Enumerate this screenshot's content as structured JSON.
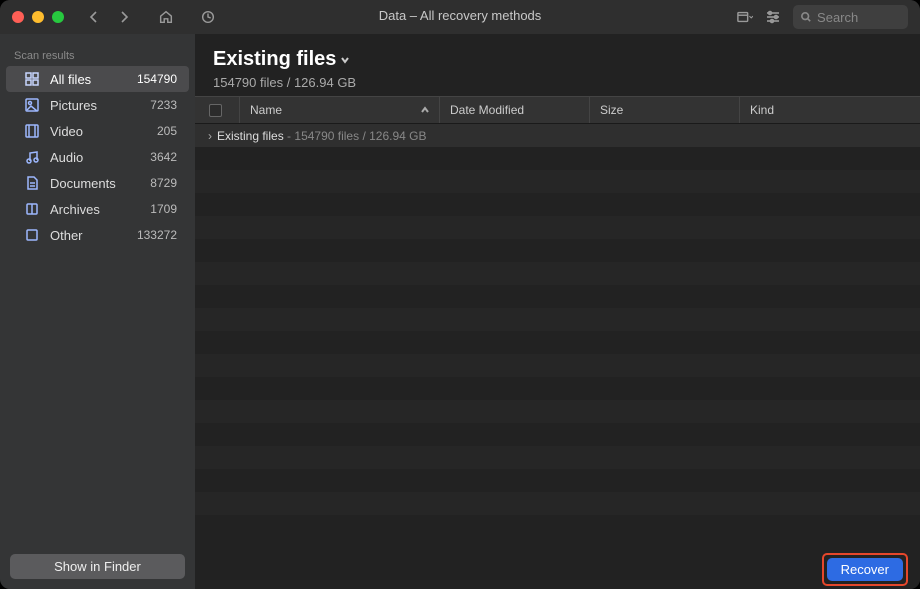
{
  "title": "Data – All recovery methods",
  "search": {
    "placeholder": "Search"
  },
  "sidebar": {
    "heading": "Scan results",
    "items": [
      {
        "label": "All files",
        "count": "154790",
        "icon": "grid"
      },
      {
        "label": "Pictures",
        "count": "7233",
        "icon": "image"
      },
      {
        "label": "Video",
        "count": "205",
        "icon": "film"
      },
      {
        "label": "Audio",
        "count": "3642",
        "icon": "music"
      },
      {
        "label": "Documents",
        "count": "8729",
        "icon": "doc"
      },
      {
        "label": "Archives",
        "count": "1709",
        "icon": "archive"
      },
      {
        "label": "Other",
        "count": "133272",
        "icon": "other"
      }
    ],
    "finder_button": "Show in Finder"
  },
  "heading": {
    "title": "Existing files",
    "subtitle": "154790 files / 126.94 GB"
  },
  "columns": {
    "name": "Name",
    "date": "Date Modified",
    "size": "Size",
    "kind": "Kind"
  },
  "row0": {
    "name": "Existing files",
    "detail": "154790 files / 126.94 GB"
  },
  "recover_label": "Recover"
}
